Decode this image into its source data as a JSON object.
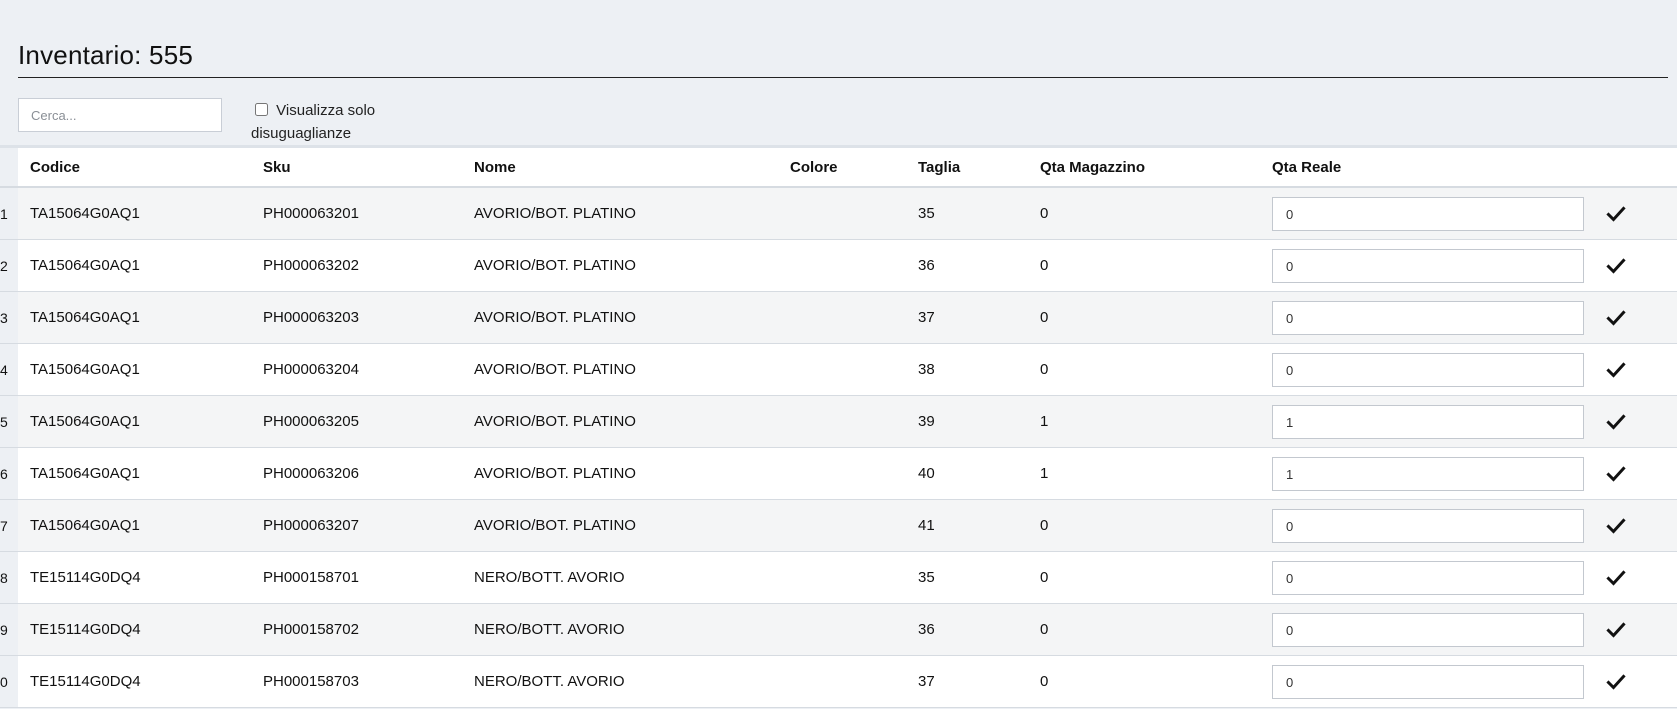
{
  "page": {
    "title": "Inventario: 555"
  },
  "search": {
    "placeholder": "Cerca..."
  },
  "filter": {
    "label": "Visualizza solo disuguaglianze",
    "checked": false
  },
  "table": {
    "headers": {
      "codice": "Codice",
      "sku": "Sku",
      "nome": "Nome",
      "colore": "Colore",
      "taglia": "Taglia",
      "qta_magazzino": "Qta Magazzino",
      "qta_reale": "Qta Reale"
    },
    "rows": [
      {
        "idx": "1",
        "codice": "TA15064G0AQ1",
        "sku": "PH000063201",
        "nome": "AVORIO/BOT. PLATINO",
        "colore": "",
        "taglia": "35",
        "qta_magazzino": "0",
        "qta_reale": "0"
      },
      {
        "idx": "2",
        "codice": "TA15064G0AQ1",
        "sku": "PH000063202",
        "nome": "AVORIO/BOT. PLATINO",
        "colore": "",
        "taglia": "36",
        "qta_magazzino": "0",
        "qta_reale": "0"
      },
      {
        "idx": "3",
        "codice": "TA15064G0AQ1",
        "sku": "PH000063203",
        "nome": "AVORIO/BOT. PLATINO",
        "colore": "",
        "taglia": "37",
        "qta_magazzino": "0",
        "qta_reale": "0"
      },
      {
        "idx": "4",
        "codice": "TA15064G0AQ1",
        "sku": "PH000063204",
        "nome": "AVORIO/BOT. PLATINO",
        "colore": "",
        "taglia": "38",
        "qta_magazzino": "0",
        "qta_reale": "0"
      },
      {
        "idx": "5",
        "codice": "TA15064G0AQ1",
        "sku": "PH000063205",
        "nome": "AVORIO/BOT. PLATINO",
        "colore": "",
        "taglia": "39",
        "qta_magazzino": "1",
        "qta_reale": "1"
      },
      {
        "idx": "6",
        "codice": "TA15064G0AQ1",
        "sku": "PH000063206",
        "nome": "AVORIO/BOT. PLATINO",
        "colore": "",
        "taglia": "40",
        "qta_magazzino": "1",
        "qta_reale": "1"
      },
      {
        "idx": "7",
        "codice": "TA15064G0AQ1",
        "sku": "PH000063207",
        "nome": "AVORIO/BOT. PLATINO",
        "colore": "",
        "taglia": "41",
        "qta_magazzino": "0",
        "qta_reale": "0"
      },
      {
        "idx": "8",
        "codice": "TE15114G0DQ4",
        "sku": "PH000158701",
        "nome": "NERO/BOTT. AVORIO",
        "colore": "",
        "taglia": "35",
        "qta_magazzino": "0",
        "qta_reale": "0"
      },
      {
        "idx": "9",
        "codice": "TE15114G0DQ4",
        "sku": "PH000158702",
        "nome": "NERO/BOTT. AVORIO",
        "colore": "",
        "taglia": "36",
        "qta_magazzino": "0",
        "qta_reale": "0"
      },
      {
        "idx": "0",
        "codice": "TE15114G0DQ4",
        "sku": "PH000158703",
        "nome": "NERO/BOTT. AVORIO",
        "colore": "",
        "taglia": "37",
        "qta_magazzino": "0",
        "qta_reale": "0"
      }
    ],
    "confirm_icon": "checkmark-icon"
  }
}
